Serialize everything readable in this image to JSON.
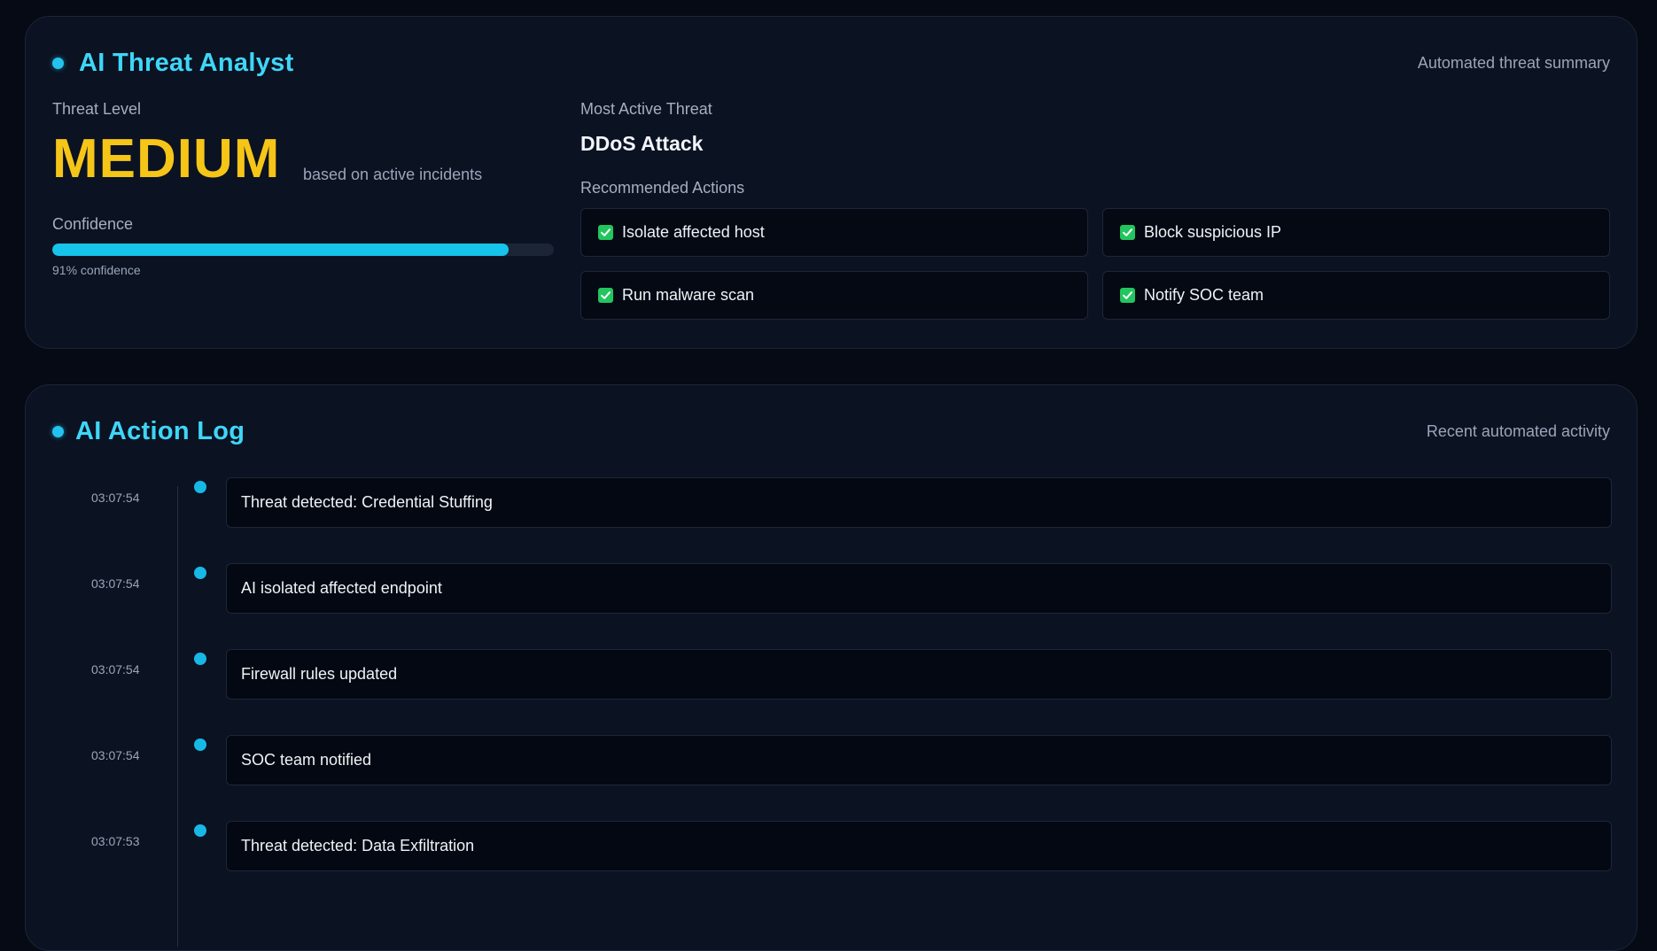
{
  "analyst": {
    "title": "AI Threat Analyst",
    "subtitle": "Automated threat summary",
    "threat_level_label": "Threat Level",
    "threat_level_value": "MEDIUM",
    "threat_level_note": "based on active incidents",
    "threat_level_color": "#f5c518",
    "confidence_label": "Confidence",
    "confidence_percent": 91,
    "confidence_text": "91% confidence",
    "most_active_label": "Most Active Threat",
    "most_active_value": "DDoS Attack",
    "recommended_label": "Recommended Actions",
    "actions": [
      {
        "label": "Isolate affected host",
        "icon": "check-icon"
      },
      {
        "label": "Block suspicious IP",
        "icon": "check-icon"
      },
      {
        "label": "Run malware scan",
        "icon": "check-icon"
      },
      {
        "label": "Notify SOC team",
        "icon": "check-icon"
      }
    ]
  },
  "log": {
    "title": "AI Action Log",
    "subtitle": "Recent automated activity",
    "entries": [
      {
        "time": "03:07:54",
        "text": "Threat detected: Credential Stuffing"
      },
      {
        "time": "03:07:54",
        "text": "AI isolated affected endpoint"
      },
      {
        "time": "03:07:54",
        "text": "Firewall rules updated"
      },
      {
        "time": "03:07:54",
        "text": "SOC team notified"
      },
      {
        "time": "03:07:53",
        "text": "Threat detected: Data Exfiltration"
      }
    ]
  },
  "colors": {
    "accent": "#3ed6f7",
    "success": "#22c55e",
    "warning": "#f5c518"
  }
}
